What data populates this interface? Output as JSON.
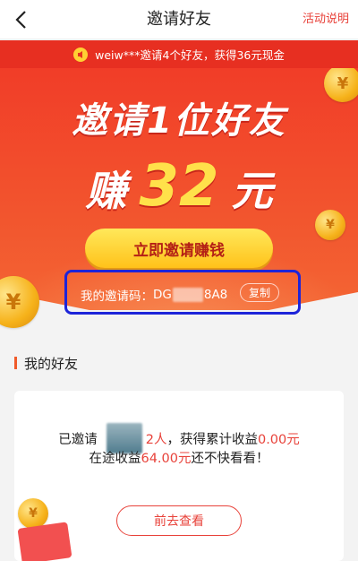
{
  "header": {
    "title": "邀请好友",
    "right_link": "活动说明"
  },
  "ticker": {
    "text": "weiw***邀请4个好友，获得36元现金"
  },
  "hero": {
    "headline_line1": "邀请1位好友",
    "headline_prefix": "赚",
    "headline_amount": "32",
    "headline_suffix": "元",
    "invite_button": "立即邀请赚钱",
    "code_label": "我的邀请码：",
    "code_prefix": "DG",
    "code_suffix": "8A8",
    "copy_button": "复制"
  },
  "friends": {
    "section_title": "我的好友",
    "invited_label": "已邀请",
    "invited_count": "2人",
    "earned_label": "，获得累计收益",
    "earned_amount": "0.00元",
    "pending_label": "在途收益",
    "pending_amount": "64.00元",
    "pending_suffix": "还不快看看！",
    "go_button": "前去查看"
  },
  "colors": {
    "brand_red": "#e8423a",
    "ticker_red": "#e72f21",
    "gold": "#ffd033",
    "highlight_box": "#1d24d9"
  }
}
